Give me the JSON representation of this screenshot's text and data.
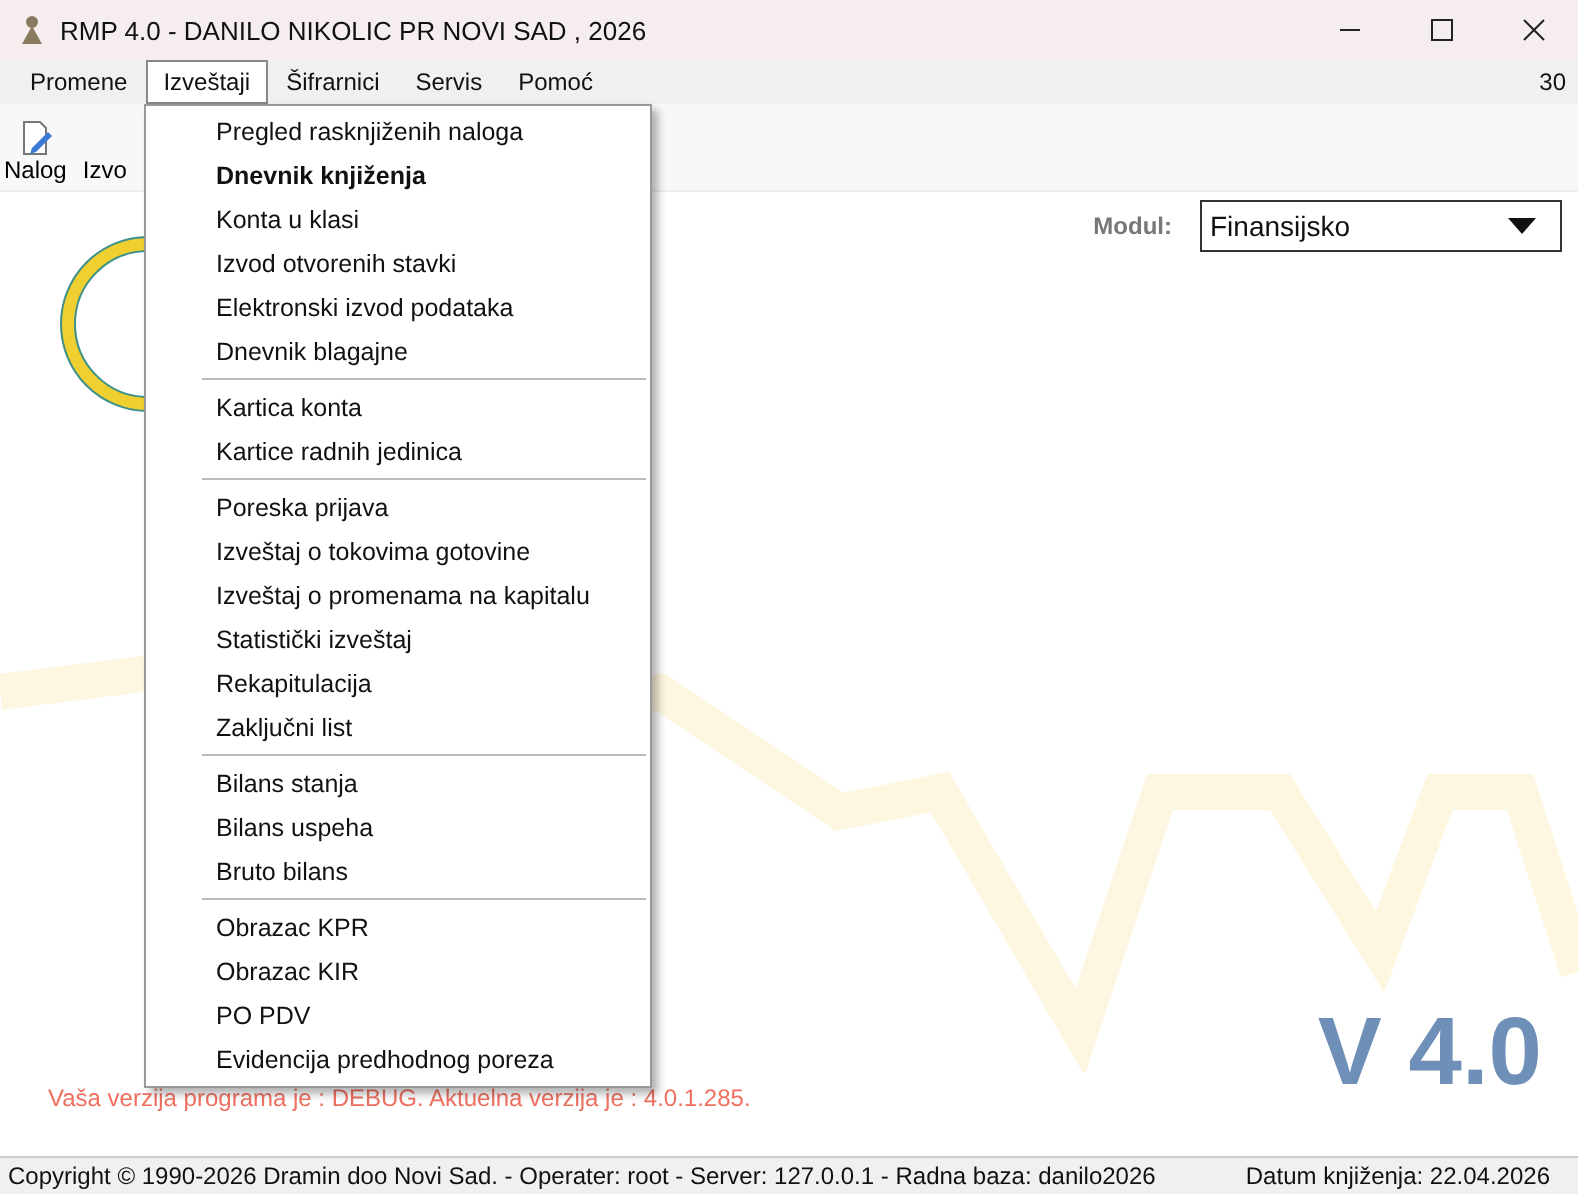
{
  "window": {
    "title": "RMP 4.0 - DANILO NIKOLIC PR NOVI SAD , 2026"
  },
  "menubar": {
    "items": [
      {
        "label": "Promene",
        "selected": false
      },
      {
        "label": "Izveštaji",
        "selected": true
      },
      {
        "label": "Šifrarnici",
        "selected": false
      },
      {
        "label": "Servis",
        "selected": false
      },
      {
        "label": "Pomoć",
        "selected": false
      }
    ],
    "right_text": "30"
  },
  "toolbar": [
    {
      "label": "Nalog",
      "kind": "icon"
    },
    {
      "label": "Izvo",
      "kind": "text"
    }
  ],
  "module": {
    "label": "Modul:",
    "value": "Finansijsko"
  },
  "dropdown_menu": {
    "sections": [
      [
        {
          "label": "Pregled rasknjiženih naloga",
          "bold": false
        },
        {
          "label": "Dnevnik knjiženja",
          "bold": true
        },
        {
          "label": "Konta u klasi",
          "bold": false
        },
        {
          "label": "Izvod otvorenih stavki",
          "bold": false
        },
        {
          "label": "Elektronski izvod podataka",
          "bold": false
        },
        {
          "label": "Dnevnik blagajne",
          "bold": false
        }
      ],
      [
        {
          "label": "Kartica konta",
          "bold": false
        },
        {
          "label": "Kartice radnih jedinica",
          "bold": false
        }
      ],
      [
        {
          "label": "Poreska prijava",
          "bold": false
        },
        {
          "label": "Izveštaj o tokovima gotovine",
          "bold": false
        },
        {
          "label": "Izveštaj o promenama na kapitalu",
          "bold": false
        },
        {
          "label": "Statistički izveštaj",
          "bold": false
        },
        {
          "label": "Rekapitulacija",
          "bold": false
        },
        {
          "label": "Zaključni list",
          "bold": false
        }
      ],
      [
        {
          "label": "Bilans stanja",
          "bold": false
        },
        {
          "label": "Bilans uspeha",
          "bold": false
        },
        {
          "label": "Bruto bilans",
          "bold": false
        }
      ],
      [
        {
          "label": "Obrazac KPR",
          "bold": false
        },
        {
          "label": "Obrazac KIR",
          "bold": false
        },
        {
          "label": "PO PDV",
          "bold": false
        },
        {
          "label": "Evidencija predhodnog poreza",
          "bold": false
        }
      ]
    ]
  },
  "version_notice": "Vaša verzija programa je : DEBUG. Aktuelna verzija je : 4.0.1.285.",
  "version_label": "V 4.0",
  "status_bar": {
    "left": "Copyright © 1990-2026 Dramin doo Novi Sad. - Operater: root - Server: 127.0.0.1 - Radna baza: danilo2026",
    "right": "Datum knjiženja: 22.04.2026"
  }
}
